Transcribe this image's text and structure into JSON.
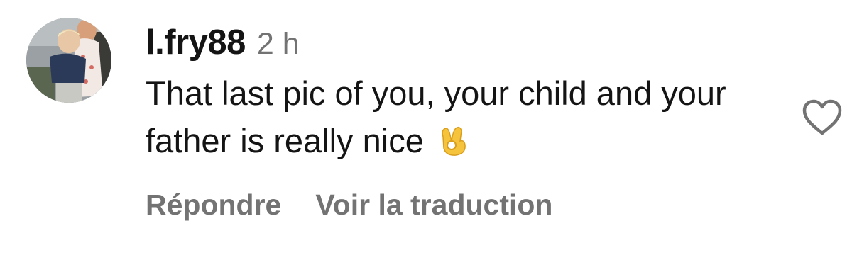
{
  "comment": {
    "username": "l.fry88",
    "time": "2 h",
    "text": "That last pic of you, your child and your father is really nice",
    "emoji": "ok-hand-emoji",
    "actions": {
      "reply": "Répondre",
      "translate": "Voir la traduction"
    },
    "icons": {
      "like": "heart-outline-icon"
    }
  },
  "colors": {
    "text": "#141414",
    "secondary": "#737373"
  }
}
